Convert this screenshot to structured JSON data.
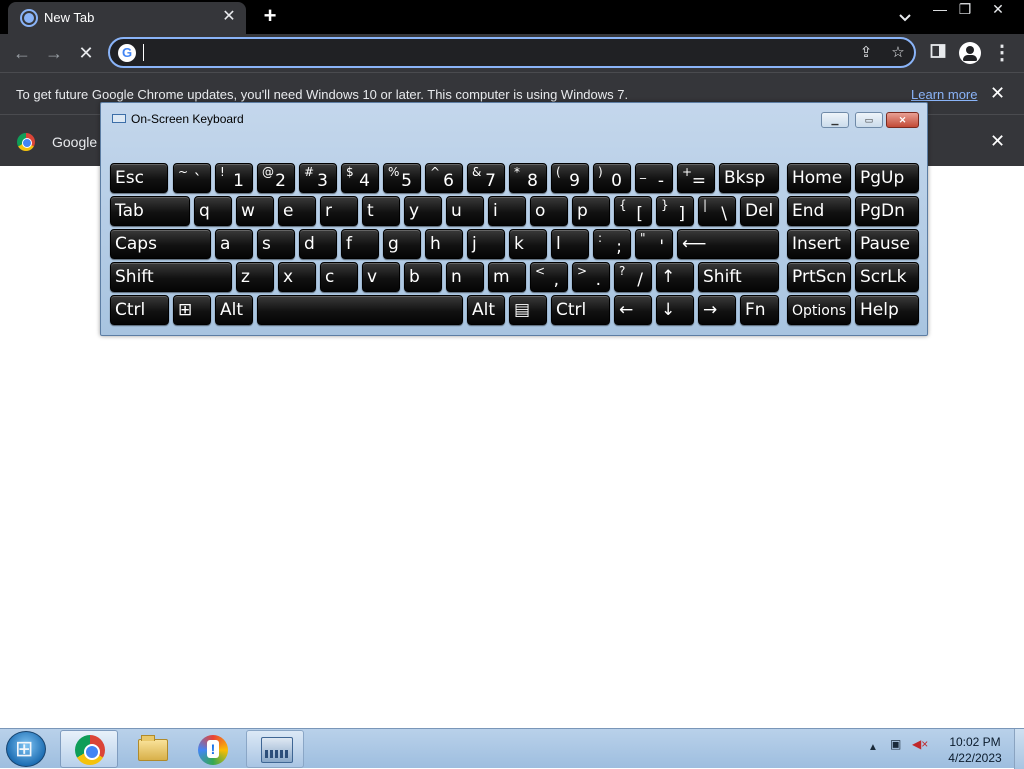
{
  "browser": {
    "tab_title": "New Tab",
    "tab_close": "✕",
    "new_tab": "+",
    "tab_search": "⌄",
    "window_controls": {
      "minimize": "—",
      "restore": "❐",
      "close": "✕"
    },
    "nav": {
      "back": "←",
      "forward": "→",
      "stop": "✕"
    },
    "omnibox": {
      "google_icon": "G",
      "value": "",
      "placeholder": ""
    },
    "omnibox_icons": {
      "share": "⇪",
      "bookmark": "☆"
    },
    "toolbar_icons": {
      "side_panel": "▯",
      "menu": "⋮"
    }
  },
  "infobar_update": {
    "message": "To get future Google Chrome updates, you'll need Windows 10 or later. This computer is using Windows 7.",
    "link": "Learn more",
    "close": "✕"
  },
  "infobar_second": {
    "label": "Google C",
    "close": "✕"
  },
  "osk": {
    "title": "On-Screen Keyboard",
    "controls": {
      "minimize": "▁",
      "restore": "▭",
      "close": "✕"
    },
    "rows": [
      [
        {
          "label": "Esc"
        },
        {
          "shift": "~",
          "main": "`"
        },
        {
          "shift": "!",
          "main": "1"
        },
        {
          "shift": "@",
          "main": "2"
        },
        {
          "shift": "#",
          "main": "3"
        },
        {
          "shift": "$",
          "main": "4"
        },
        {
          "shift": "%",
          "main": "5"
        },
        {
          "shift": "^",
          "main": "6"
        },
        {
          "shift": "&",
          "main": "7"
        },
        {
          "shift": "*",
          "main": "8"
        },
        {
          "shift": "(",
          "main": "9"
        },
        {
          "shift": ")",
          "main": "0"
        },
        {
          "shift": "_",
          "main": "-"
        },
        {
          "shift": "+",
          "main": "="
        },
        {
          "label": "Bksp"
        },
        {
          "label": "Home"
        },
        {
          "label": "PgUp"
        }
      ],
      [
        {
          "label": "Tab"
        },
        {
          "label": "q"
        },
        {
          "label": "w"
        },
        {
          "label": "e"
        },
        {
          "label": "r"
        },
        {
          "label": "t"
        },
        {
          "label": "y"
        },
        {
          "label": "u"
        },
        {
          "label": "i"
        },
        {
          "label": "o"
        },
        {
          "label": "p"
        },
        {
          "shift": "{",
          "main": "["
        },
        {
          "shift": "}",
          "main": "]"
        },
        {
          "shift": "|",
          "main": "\\"
        },
        {
          "label": "Del"
        },
        {
          "label": "End"
        },
        {
          "label": "PgDn"
        }
      ],
      [
        {
          "label": "Caps"
        },
        {
          "label": "a"
        },
        {
          "label": "s"
        },
        {
          "label": "d"
        },
        {
          "label": "f"
        },
        {
          "label": "g"
        },
        {
          "label": "h"
        },
        {
          "label": "j"
        },
        {
          "label": "k"
        },
        {
          "label": "l"
        },
        {
          "shift": ":",
          "main": ";"
        },
        {
          "shift": "\"",
          "main": "'"
        },
        {
          "label": "⟵"
        },
        {
          "label": "Insert"
        },
        {
          "label": "Pause"
        }
      ],
      [
        {
          "label": "Shift"
        },
        {
          "label": "z"
        },
        {
          "label": "x"
        },
        {
          "label": "c"
        },
        {
          "label": "v"
        },
        {
          "label": "b"
        },
        {
          "label": "n"
        },
        {
          "label": "m"
        },
        {
          "shift": "<",
          "main": ","
        },
        {
          "shift": ">",
          "main": "."
        },
        {
          "shift": "?",
          "main": "/"
        },
        {
          "label": "↑"
        },
        {
          "label": "Shift"
        },
        {
          "label": "PrtScn"
        },
        {
          "label": "ScrLk"
        }
      ],
      [
        {
          "label": "Ctrl"
        },
        {
          "label": "⊞"
        },
        {
          "label": "Alt"
        },
        {
          "label": ""
        },
        {
          "label": "Alt"
        },
        {
          "label": "▤"
        },
        {
          "label": "Ctrl"
        },
        {
          "label": "←"
        },
        {
          "label": "↓"
        },
        {
          "label": "→"
        },
        {
          "label": "Fn"
        },
        {
          "label": "Options"
        },
        {
          "label": "Help"
        }
      ]
    ]
  },
  "taskbar": {
    "tray_icons": {
      "show_hidden": "▲",
      "network": "▣",
      "volume": "◀×"
    },
    "clock": {
      "time": "10:02 PM",
      "date": "4/22/2023"
    }
  }
}
